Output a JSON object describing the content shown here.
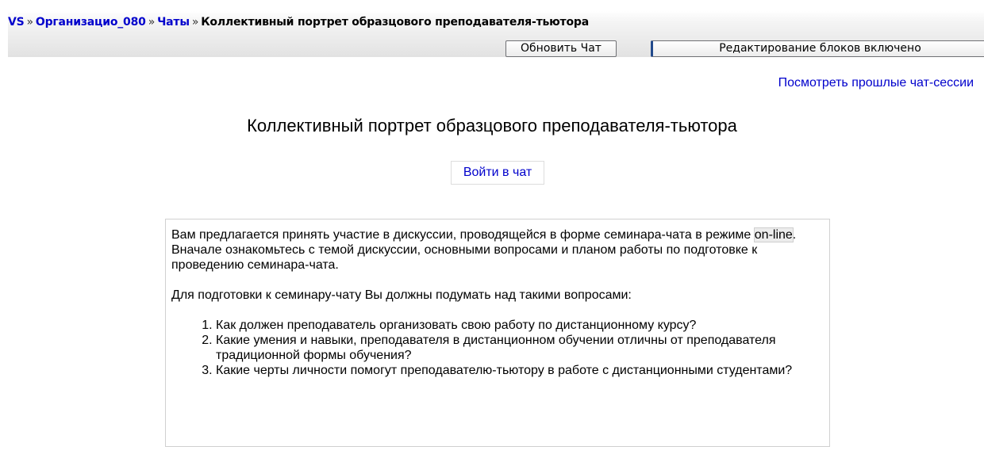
{
  "breadcrumb": {
    "home": "VS",
    "sep": "»",
    "org": "Организацио_080",
    "chats": "Чаты",
    "current": "Коллективный портрет образцового преподавателя-тьютора"
  },
  "toolbar": {
    "refresh_label": "Обновить Чат",
    "editing_label": "Редактирование блоков включено"
  },
  "links": {
    "view_past": "Посмотреть прошлые чат-сессии"
  },
  "chat": {
    "title": "Коллективный портрет образцового преподавателя-тьютора",
    "enter_label": "Войти в чат"
  },
  "intro": {
    "p1_before": "Вам предлагается принять участие в дискуссии, проводящейся в форме семинара-чата в режиме ",
    "p1_highlight": "on-line",
    "p1_after": ". Вначале ознакомьтесь с темой дискуссии, основными вопросами и планом работы по подготовке к проведению семинара-чата.",
    "p2": "Для подготовки к семинару-чату Вы должны подумать над такими вопросами:",
    "questions": [
      "Как должен преподаватель организовать свою работу по дистанционному курсу?",
      "Какие умения и навыки, преподавателя в дистанционном обучении отличны от преподавателя традиционной формы обучения?",
      "Какие черты личности помогут преподавателю-тьютору в работе с дистанционными студентами?"
    ]
  }
}
